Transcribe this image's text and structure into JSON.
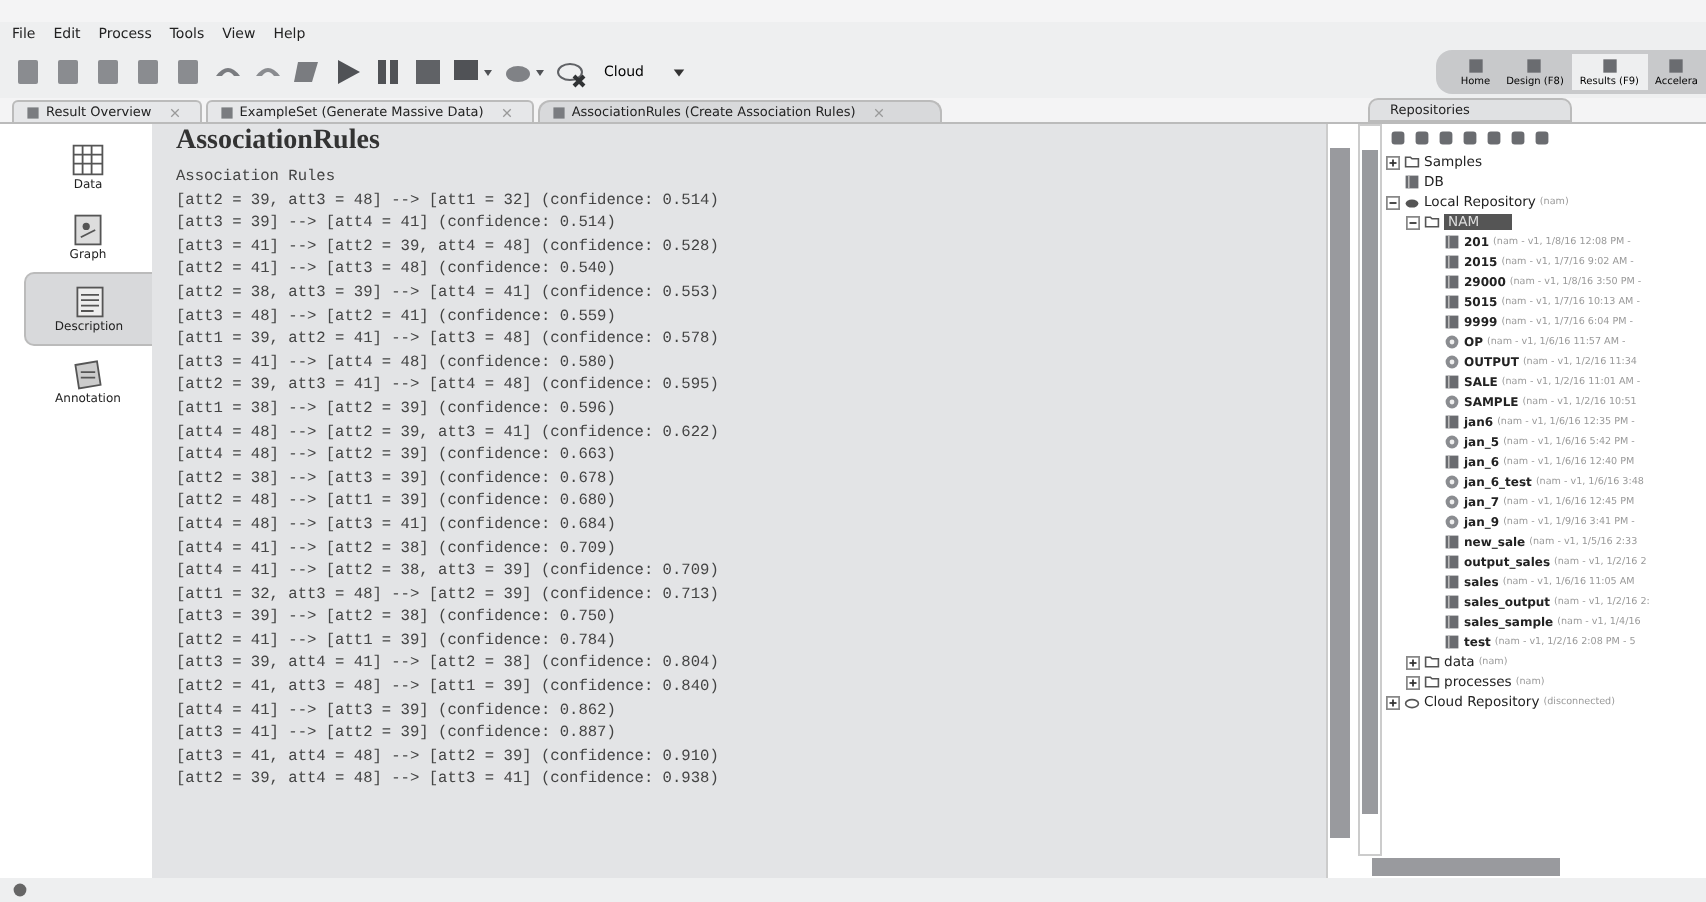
{
  "menu": [
    "File",
    "Edit",
    "Process",
    "Tools",
    "View",
    "Help"
  ],
  "toolbar": {
    "cloud": "Cloud"
  },
  "perspectives": [
    {
      "label": "Home",
      "selected": false
    },
    {
      "label": "Design (F8)",
      "selected": false
    },
    {
      "label": "Results (F9)",
      "selected": true
    },
    {
      "label": "Accelera",
      "selected": false
    }
  ],
  "tabs": [
    {
      "label": "Result Overview",
      "selected": false
    },
    {
      "label": "ExampleSet (Generate Massive Data)",
      "selected": false
    },
    {
      "label": "AssociationRules (Create Association Rules)",
      "selected": true
    }
  ],
  "views": [
    {
      "label": "Data",
      "kind": "data",
      "selected": false
    },
    {
      "label": "Graph",
      "kind": "graph",
      "selected": false
    },
    {
      "label": "Description",
      "kind": "description",
      "selected": true
    },
    {
      "label": "Annotation",
      "kind": "annotation",
      "selected": false
    }
  ],
  "result": {
    "title": "AssociationRules",
    "heading": "Association Rules",
    "rules": [
      "[att2 = 39, att3 = 48] --> [att1 = 32] (confidence: 0.514)",
      "[att3 = 39] --> [att4 = 41] (confidence: 0.514)",
      "[att3 = 41] --> [att2 = 39, att4 = 48] (confidence: 0.528)",
      "[att2 = 41] --> [att3 = 48] (confidence: 0.540)",
      "[att2 = 38, att3 = 39] --> [att4 = 41] (confidence: 0.553)",
      "[att3 = 48] --> [att2 = 41] (confidence: 0.559)",
      "[att1 = 39, att2 = 41] --> [att3 = 48] (confidence: 0.578)",
      "[att3 = 41] --> [att4 = 48] (confidence: 0.580)",
      "[att2 = 39, att3 = 41] --> [att4 = 48] (confidence: 0.595)",
      "[att1 = 38] --> [att2 = 39] (confidence: 0.596)",
      "[att4 = 48] --> [att2 = 39, att3 = 41] (confidence: 0.622)",
      "[att4 = 48] --> [att2 = 39] (confidence: 0.663)",
      "[att2 = 38] --> [att3 = 39] (confidence: 0.678)",
      "[att2 = 48] --> [att1 = 39] (confidence: 0.680)",
      "[att4 = 48] --> [att3 = 41] (confidence: 0.684)",
      "[att4 = 41] --> [att2 = 38] (confidence: 0.709)",
      "[att4 = 41] --> [att2 = 38, att3 = 39] (confidence: 0.709)",
      "[att1 = 32, att3 = 48] --> [att2 = 39] (confidence: 0.713)",
      "[att3 = 39] --> [att2 = 38] (confidence: 0.750)",
      "[att2 = 41] --> [att1 = 39] (confidence: 0.784)",
      "[att3 = 39, att4 = 41] --> [att2 = 38] (confidence: 0.804)",
      "[att2 = 41, att3 = 48] --> [att1 = 39] (confidence: 0.840)",
      "[att4 = 41] --> [att3 = 39] (confidence: 0.862)",
      "[att3 = 41] --> [att2 = 39] (confidence: 0.887)",
      "[att3 = 41, att4 = 48] --> [att2 = 39] (confidence: 0.910)",
      "[att2 = 39, att4 = 48] --> [att3 = 41] (confidence: 0.938)"
    ]
  },
  "repositories": {
    "title": "Repositories",
    "tree": [
      {
        "label": "Samples",
        "kind": "folder",
        "expanded": false
      },
      {
        "label": "DB",
        "kind": "data"
      },
      {
        "label": "Local Repository",
        "meta": "(nam)",
        "kind": "repo",
        "expanded": true,
        "children": [
          {
            "label": "NAM",
            "kind": "folder",
            "expanded": true,
            "selected": true,
            "children": [
              {
                "label": "201",
                "meta": "(nam - v1, 1/8/16 12:08 PM -",
                "kind": "data"
              },
              {
                "label": "2015",
                "meta": "(nam - v1, 1/7/16 9:02 AM -",
                "kind": "data"
              },
              {
                "label": "29000",
                "meta": "(nam - v1, 1/8/16 3:50 PM -",
                "kind": "data"
              },
              {
                "label": "5015",
                "meta": "(nam - v1, 1/7/16 10:13 AM -",
                "kind": "data"
              },
              {
                "label": "9999",
                "meta": "(nam - v1, 1/7/16 6:04 PM -",
                "kind": "data"
              },
              {
                "label": "OP",
                "meta": "(nam - v1, 1/6/16 11:57 AM -",
                "kind": "process"
              },
              {
                "label": "OUTPUT",
                "meta": "(nam - v1, 1/2/16 11:34",
                "kind": "process"
              },
              {
                "label": "SALE",
                "meta": "(nam - v1, 1/2/16 11:01 AM -",
                "kind": "data"
              },
              {
                "label": "SAMPLE",
                "meta": "(nam - v1, 1/2/16 10:51",
                "kind": "process"
              },
              {
                "label": "jan6",
                "meta": "(nam - v1, 1/6/16 12:35 PM -",
                "kind": "data"
              },
              {
                "label": "jan_5",
                "meta": "(nam - v1, 1/6/16 5:42 PM -",
                "kind": "process"
              },
              {
                "label": "jan_6",
                "meta": "(nam - v1, 1/6/16 12:40 PM",
                "kind": "data"
              },
              {
                "label": "jan_6_test",
                "meta": "(nam - v1, 1/6/16 3:48",
                "kind": "process"
              },
              {
                "label": "jan_7",
                "meta": "(nam - v1, 1/6/16 12:45 PM",
                "kind": "process"
              },
              {
                "label": "jan_9",
                "meta": "(nam - v1, 1/9/16 3:41 PM -",
                "kind": "process"
              },
              {
                "label": "new_sale",
                "meta": "(nam - v1, 1/5/16 2:33",
                "kind": "data"
              },
              {
                "label": "output_sales",
                "meta": "(nam - v1, 1/2/16 2",
                "kind": "data"
              },
              {
                "label": "sales",
                "meta": "(nam - v1, 1/6/16 11:05 AM",
                "kind": "data"
              },
              {
                "label": "sales_output",
                "meta": "(nam - v1, 1/2/16 2:",
                "kind": "data"
              },
              {
                "label": "sales_sample",
                "meta": "(nam - v1, 1/4/16",
                "kind": "data"
              },
              {
                "label": "test",
                "meta": "(nam - v1, 1/2/16 2:08 PM - 5",
                "kind": "data"
              }
            ]
          },
          {
            "label": "data",
            "meta": "(nam)",
            "kind": "folder",
            "expanded": false
          },
          {
            "label": "processes",
            "meta": "(nam)",
            "kind": "folder",
            "expanded": false
          }
        ]
      },
      {
        "label": "Cloud Repository",
        "meta": "(disconnected)",
        "kind": "cloud",
        "expanded": false
      }
    ]
  }
}
